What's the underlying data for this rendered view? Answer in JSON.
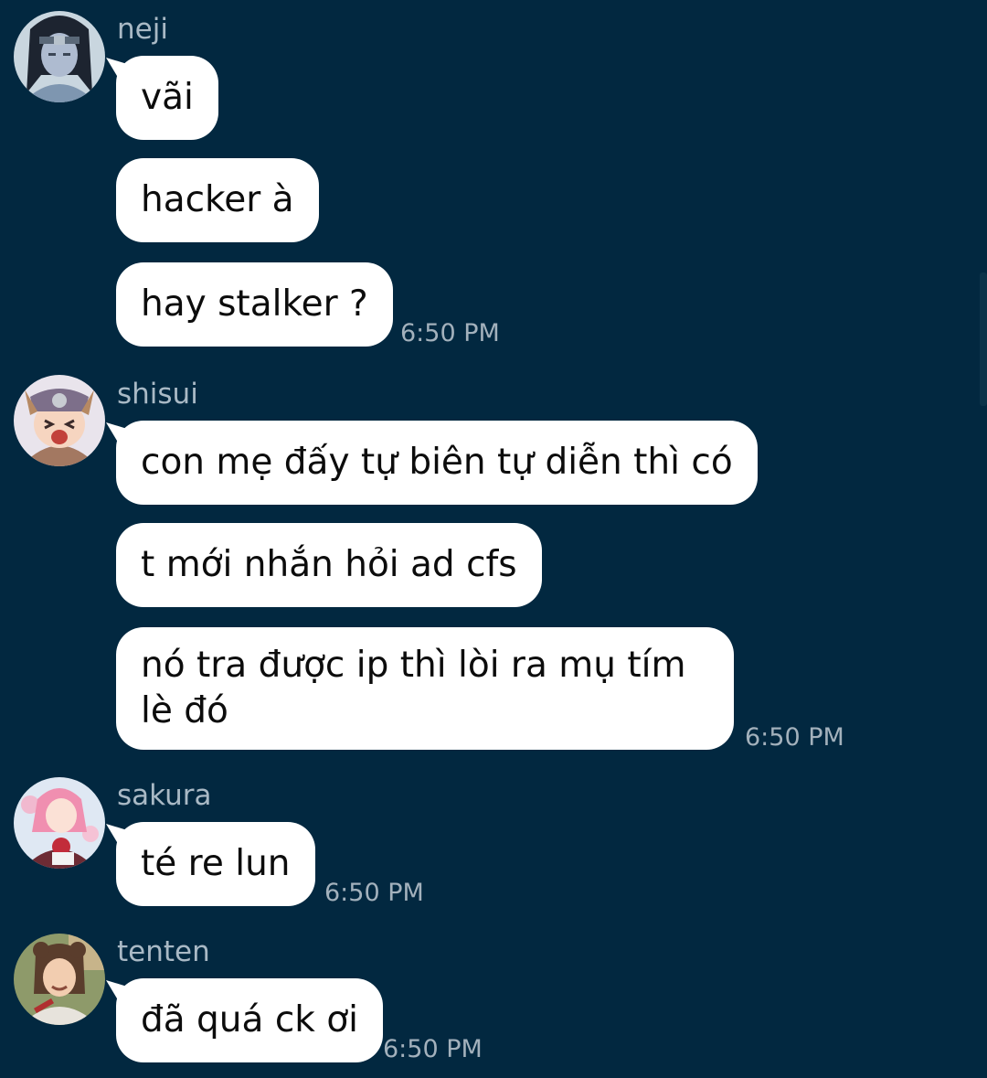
{
  "colors": {
    "background": "#022840",
    "bubble": "#ffffff",
    "sender_name": "#a9b9c5",
    "timestamp": "#a3b1bc"
  },
  "groups": [
    {
      "sender": "neji",
      "avatar_icon": "neji-avatar-icon",
      "messages": [
        "vãi",
        "hacker à",
        "hay stalker ?"
      ],
      "time": "6:50 PM"
    },
    {
      "sender": "shisui",
      "avatar_icon": "shisui-avatar-icon",
      "messages": [
        "con mẹ đấy tự biên tự diễn thì có",
        "t mới nhắn hỏi ad cfs",
        "nó tra được ip thì lòi ra mụ tím lè đó"
      ],
      "time": "6:50 PM"
    },
    {
      "sender": "sakura",
      "avatar_icon": "sakura-avatar-icon",
      "messages": [
        "té re lun"
      ],
      "time": "6:50 PM"
    },
    {
      "sender": "tenten",
      "avatar_icon": "tenten-avatar-icon",
      "messages": [
        "đã quá ck ơi"
      ],
      "time": "6:50 PM"
    }
  ]
}
